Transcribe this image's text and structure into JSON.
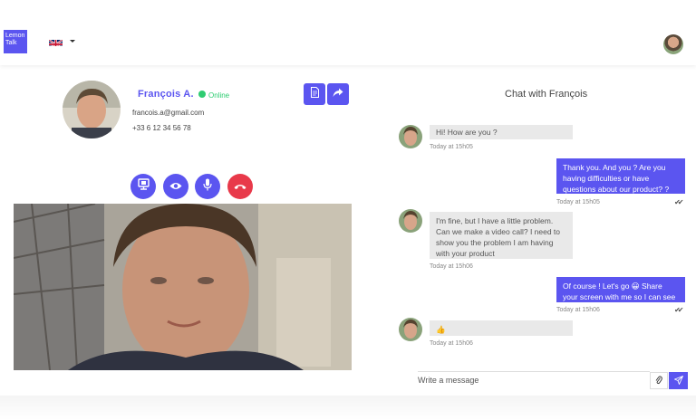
{
  "header": {
    "logo_line1": "Lemon",
    "logo_line2": "Talk",
    "language_flag": "uk-flag-icon"
  },
  "contact": {
    "name": "François A.",
    "status": "Online",
    "email": "francois.a@gmail.com",
    "phone": "+33 6 12 34 56 78"
  },
  "actions": {
    "icons": [
      "document-icon",
      "share-icon"
    ]
  },
  "call_controls": {
    "icons": [
      "screen-share-icon",
      "eye-icon",
      "microphone-icon",
      "hang-up-icon"
    ]
  },
  "chat": {
    "title": "Chat with François",
    "messages": [
      {
        "from": "contact",
        "text": "Hi! How are you ?",
        "time": "Today at 15h05"
      },
      {
        "from": "me",
        "text": "Thank you. And you ? Are you having difficulties or have questions about our product? ?",
        "time": "Today at 15h05"
      },
      {
        "from": "contact",
        "text": "I'm fine, but I have a little problem. Can we make a video call? I need to show you the problem I am having with your product",
        "time": "Today at 15h06"
      },
      {
        "from": "me",
        "text": "Of course ! Let's go 😀 Share your screen with me so I can see it live",
        "time": "Today at 15h06"
      },
      {
        "from": "contact",
        "text": "👍",
        "time": "Today at 15h06"
      }
    ],
    "composer_placeholder": "Write a message",
    "read_ticks": "✔✔"
  },
  "colors": {
    "accent": "#5b55f0",
    "online": "#2ecc71",
    "hangup": "#e8394a"
  }
}
